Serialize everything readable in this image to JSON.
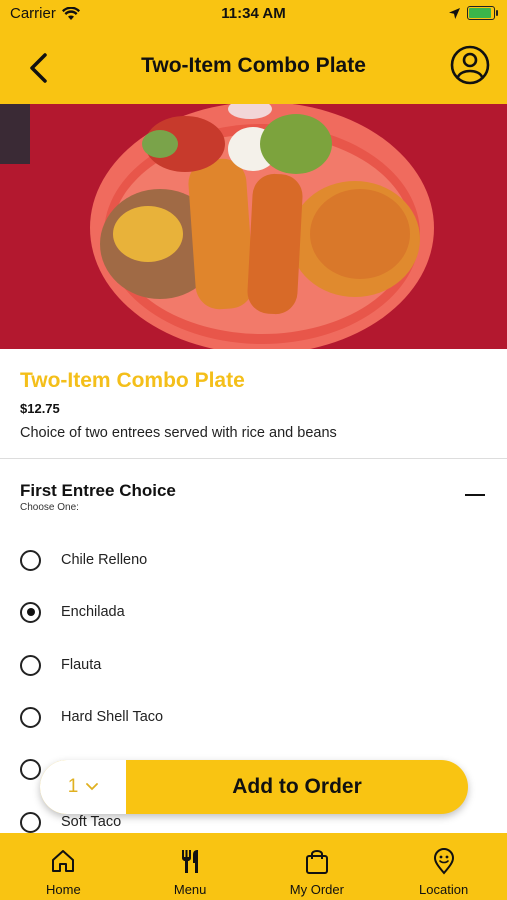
{
  "status": {
    "carrier": "Carrier",
    "time": "11:34 AM"
  },
  "header": {
    "title": "Two-Item Combo Plate"
  },
  "item": {
    "name": "Two-Item Combo Plate",
    "price": "$12.75",
    "description": "Choice of two entrees served with rice and beans"
  },
  "section": {
    "title": "First Entree Choice",
    "subtitle": "Choose One:",
    "options": [
      {
        "label": "Chile Relleno",
        "selected": false
      },
      {
        "label": "Enchilada",
        "selected": true
      },
      {
        "label": "Flauta",
        "selected": false
      },
      {
        "label": "Hard Shell Taco",
        "selected": false
      },
      {
        "label": "",
        "selected": false
      },
      {
        "label": "Soft Taco",
        "selected": false
      }
    ]
  },
  "order": {
    "quantity": "1",
    "add_label": "Add to Order"
  },
  "tabs": [
    {
      "label": "Home",
      "icon": "home-icon"
    },
    {
      "label": "Menu",
      "icon": "fork-knife-icon"
    },
    {
      "label": "My Order",
      "icon": "bag-icon"
    },
    {
      "label": "Location",
      "icon": "location-icon"
    }
  ],
  "colors": {
    "brand_yellow": "#f9c412",
    "title_gold": "#f4bf1a"
  }
}
